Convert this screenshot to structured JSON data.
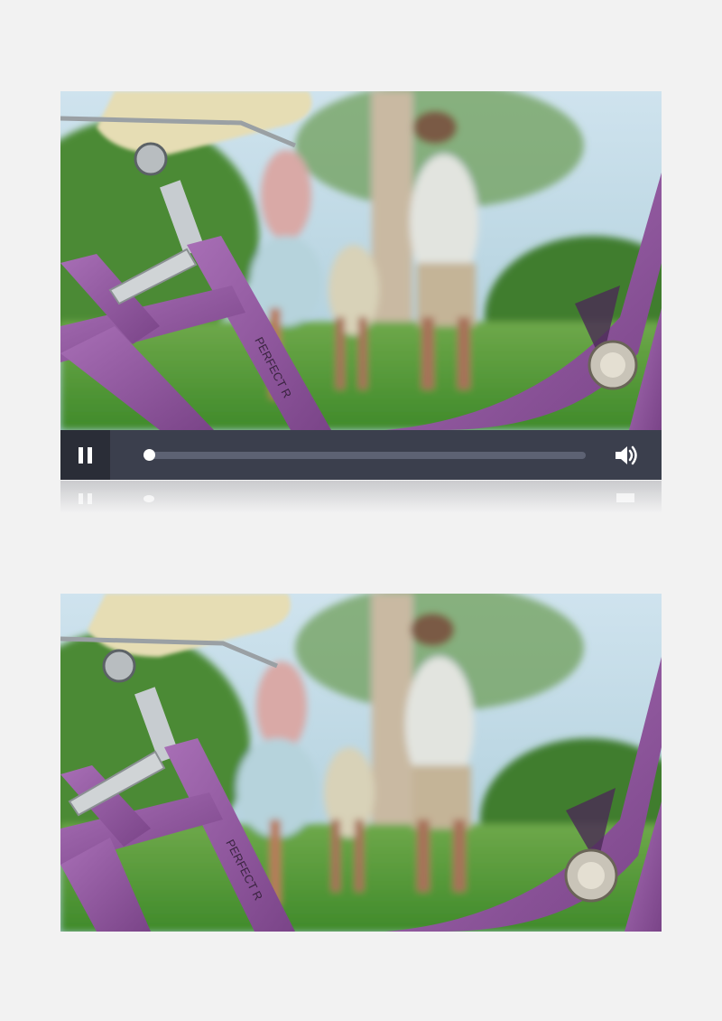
{
  "player_top": {
    "state": "playing",
    "progress": 0,
    "controls": {
      "pause_icon": "pause-icon",
      "volume_icon": "volume-icon"
    },
    "frame_imprint": "PERFECT R"
  },
  "player_bottom": {
    "state": "paused",
    "frame_imprint": "PERFECT R"
  },
  "colors": {
    "page_background": "#f2f2f2",
    "control_bar": "#3b3f4d",
    "pause_button_background": "#2a2d37",
    "progress_track": "#5d6273",
    "bike_frame": "#8e5a9a"
  }
}
